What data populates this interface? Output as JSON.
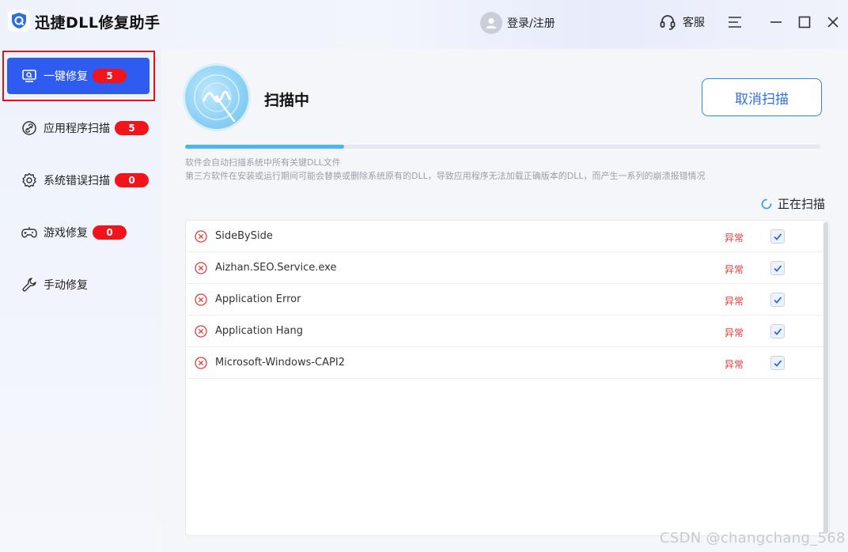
{
  "app": {
    "title": "迅捷DLL修复助手",
    "user_label": "登录/注册",
    "service_label": "客服"
  },
  "sidebar": {
    "items": [
      {
        "label": "一键修复",
        "badge": "5",
        "icon": "monitor-search-icon",
        "active": true
      },
      {
        "label": "应用程序扫描",
        "badge": "5",
        "icon": "link-icon",
        "active": false
      },
      {
        "label": "系统错误扫描",
        "badge": "0",
        "icon": "gear-icon",
        "active": false
      },
      {
        "label": "游戏修复",
        "badge": "0",
        "icon": "gamepad-icon",
        "active": false
      },
      {
        "label": "手动修复",
        "badge": null,
        "icon": "wrench-icon",
        "active": false
      }
    ]
  },
  "scan": {
    "title": "扫描中",
    "cancel_label": "取消扫描",
    "progress": 0.25,
    "desc_line1": "软件会自动扫描系统中所有关键DLL文件",
    "desc_line2": "第三方软件在安装或运行期间可能会替换或删除系统原有的DLL，导致应用程序无法加载正确版本的DLL，而产生一系列的崩溃报错情况",
    "status_label": "正在扫描"
  },
  "results": [
    {
      "name": "SideBySide",
      "status": "异常",
      "checked": true
    },
    {
      "name": "Aizhan.SEO.Service.exe",
      "status": "异常",
      "checked": true
    },
    {
      "name": "Application Error",
      "status": "异常",
      "checked": true
    },
    {
      "name": "Application Hang",
      "status": "异常",
      "checked": true
    },
    {
      "name": "Microsoft-Windows-CAPI2",
      "status": "异常",
      "checked": true
    }
  ],
  "watermark": "CSDN @changchang_568",
  "colors": {
    "accent": "#2f5cf0",
    "badge": "#f2141a",
    "error": "#e03a3a",
    "progress": "#4ab6f0"
  }
}
